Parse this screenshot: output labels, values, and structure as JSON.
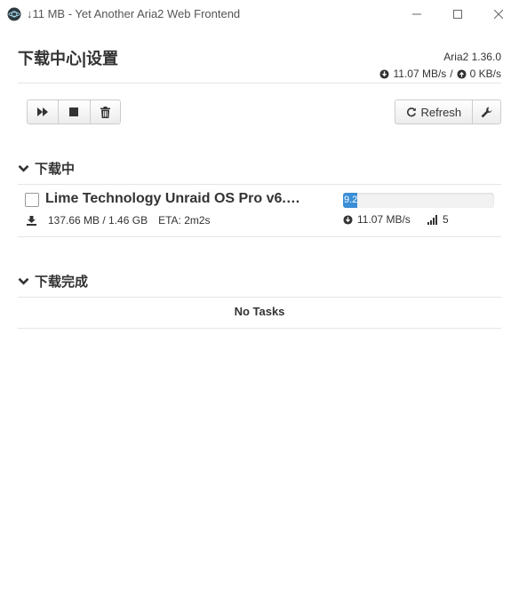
{
  "window": {
    "title": "↓11 MB - Yet Another Aria2 Web Frontend",
    "min_icon": "minimize-icon",
    "max_icon": "maximize-icon",
    "close_icon": "close-icon"
  },
  "header": {
    "title": "下载中心|设置",
    "version": "Aria2 1.36.0",
    "download_speed": "11.07 MB/s",
    "separator": "/",
    "upload_speed": "0 KB/s"
  },
  "toolbar": {
    "start_icon": "fast-forward-icon",
    "stop_icon": "stop-icon",
    "delete_icon": "trash-icon",
    "refresh_label": "Refresh",
    "refresh_icon": "refresh-icon",
    "settings_icon": "wrench-icon"
  },
  "downloading": {
    "heading": "下载中",
    "tasks": [
      {
        "name": "Lime Technology Unraid OS Pro v6.…",
        "size": "137.66 MB / 1.46 GB",
        "eta": "ETA: 2m2s",
        "progress_text": "9.2%",
        "progress_fraction": 0.092,
        "speed": "11.07 MB/s",
        "connections": "5"
      }
    ]
  },
  "completed": {
    "heading": "下载完成",
    "empty_text": "No Tasks"
  },
  "colors": {
    "accent": "#3a8fd6",
    "divider": "#e5e5e5"
  }
}
